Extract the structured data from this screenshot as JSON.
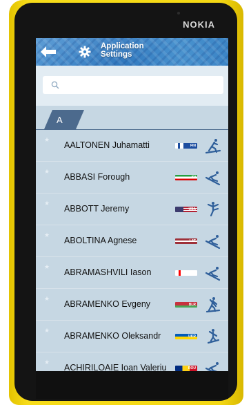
{
  "device": {
    "brand": "NOKIA"
  },
  "header": {
    "title_line1": "Application",
    "title_line2": "Settings",
    "back_icon": "back-arrow-icon",
    "settings_icon": "gear-icon"
  },
  "search": {
    "placeholder": "",
    "value": "",
    "icon": "search-icon"
  },
  "list": {
    "section_letter": "A",
    "rows": [
      {
        "name": "AALTONEN Juhamatti",
        "country": "FIN",
        "sport_icon": "cross-country-skiing-icon",
        "flag_colors": [
          "#ffffff",
          "#1d4ea0"
        ]
      },
      {
        "name": "ABBASI Forough",
        "country": "IRI",
        "sport_icon": "alpine-skiing-icon",
        "flag_colors": [
          "#239f40",
          "#ffffff",
          "#da0000"
        ]
      },
      {
        "name": "ABBOTT Jeremy",
        "country": "USA",
        "sport_icon": "figure-skating-icon",
        "flag_colors": [
          "#b22234",
          "#3c3b6e"
        ]
      },
      {
        "name": "ABOLTINA Agnese",
        "country": "LAT",
        "sport_icon": "alpine-skiing-icon",
        "flag_colors": [
          "#9e3039",
          "#ffffff"
        ]
      },
      {
        "name": "ABRAMASHVILI Iason",
        "country": "GEO",
        "sport_icon": "alpine-skiing-icon",
        "flag_colors": [
          "#ffffff",
          "#ff0000"
        ]
      },
      {
        "name": "ABRAMENKO Evgeny",
        "country": "BLR",
        "sport_icon": "biathlon-icon",
        "flag_colors": [
          "#c8313e",
          "#4aa657"
        ]
      },
      {
        "name": "ABRAMENKO Oleksandr",
        "country": "UKR",
        "sport_icon": "freestyle-skiing-icon",
        "flag_colors": [
          "#005bbb",
          "#ffd500"
        ]
      },
      {
        "name": "ACHIRILOAIE Ioan Valeriu",
        "country": "ROU",
        "sport_icon": "alpine-skiing-icon",
        "flag_colors": [
          "#002b7f",
          "#fcd116",
          "#ce1126"
        ]
      }
    ]
  },
  "colors": {
    "header_blue": "#3c86c8",
    "section_tab": "#4c6a8d",
    "list_background": "#c6d7e3",
    "icon_blue": "#2f5f9a",
    "phone_yellow": "#f4d814"
  }
}
